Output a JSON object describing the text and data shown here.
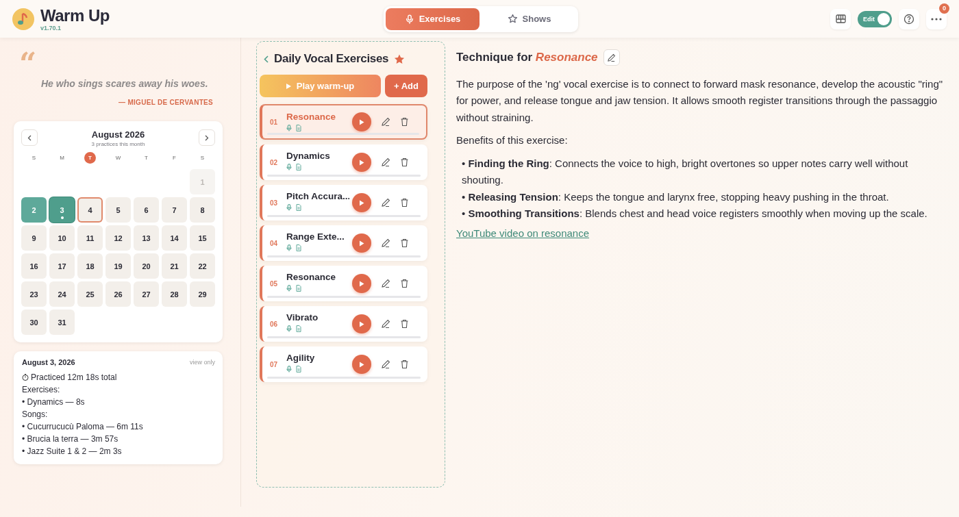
{
  "app": {
    "title": "Warm Up",
    "version": "v1.70.1"
  },
  "nav_tabs": [
    {
      "label": "Exercises",
      "selected": true
    },
    {
      "label": "Shows",
      "selected": false
    }
  ],
  "toolbar": {
    "edit_toggle": {
      "label": "Edit",
      "on": true
    },
    "notification_count": "0"
  },
  "quote": {
    "mark": "“",
    "text": "He who sings scares away his woes.",
    "author": "— MIGUEL DE CERVANTES"
  },
  "calendar": {
    "month": "August 2026",
    "subtitle": "3 practices this month",
    "weekdays": [
      {
        "label": "S",
        "selected": false
      },
      {
        "label": "M",
        "selected": false
      },
      {
        "label": "T",
        "selected": true
      },
      {
        "label": "W",
        "selected": false
      },
      {
        "label": "T",
        "selected": false
      },
      {
        "label": "F",
        "selected": false
      },
      {
        "label": "S",
        "selected": false
      }
    ],
    "days": [
      {
        "label": "1",
        "practiced": false,
        "selected": false,
        "today": false,
        "muted": true
      },
      {
        "label": "2",
        "practiced": true,
        "selected": false,
        "today": false,
        "muted": false
      },
      {
        "label": "3",
        "practiced": true,
        "selected": true,
        "today": false,
        "muted": false
      },
      {
        "label": "4",
        "practiced": false,
        "selected": false,
        "today": true,
        "muted": false
      },
      {
        "label": "5",
        "practiced": false,
        "selected": false,
        "today": false,
        "muted": false
      },
      {
        "label": "6",
        "practiced": false,
        "selected": false,
        "today": false,
        "muted": false
      },
      {
        "label": "7",
        "practiced": false,
        "selected": false,
        "today": false,
        "muted": false
      },
      {
        "label": "8",
        "practiced": false,
        "selected": false,
        "today": false,
        "muted": false
      },
      {
        "label": "9",
        "practiced": false,
        "selected": false,
        "today": false,
        "muted": false
      },
      {
        "label": "10",
        "practiced": false,
        "selected": false,
        "today": false,
        "muted": false
      },
      {
        "label": "11",
        "practiced": false,
        "selected": false,
        "today": false,
        "muted": false
      },
      {
        "label": "12",
        "practiced": false,
        "selected": false,
        "today": false,
        "muted": false
      },
      {
        "label": "13",
        "practiced": false,
        "selected": false,
        "today": false,
        "muted": false
      },
      {
        "label": "14",
        "practiced": false,
        "selected": false,
        "today": false,
        "muted": false
      },
      {
        "label": "15",
        "practiced": false,
        "selected": false,
        "today": false,
        "muted": false
      },
      {
        "label": "16",
        "practiced": false,
        "selected": false,
        "today": false,
        "muted": false
      },
      {
        "label": "17",
        "practiced": false,
        "selected": false,
        "today": false,
        "muted": false
      },
      {
        "label": "18",
        "practiced": false,
        "selected": false,
        "today": false,
        "muted": false
      },
      {
        "label": "19",
        "practiced": false,
        "selected": false,
        "today": false,
        "muted": false
      },
      {
        "label": "20",
        "practiced": false,
        "selected": false,
        "today": false,
        "muted": false
      },
      {
        "label": "21",
        "practiced": false,
        "selected": false,
        "today": false,
        "muted": false
      },
      {
        "label": "22",
        "practiced": false,
        "selected": false,
        "today": false,
        "muted": false
      },
      {
        "label": "23",
        "practiced": false,
        "selected": false,
        "today": false,
        "muted": false
      },
      {
        "label": "24",
        "practiced": false,
        "selected": false,
        "today": false,
        "muted": false
      },
      {
        "label": "25",
        "practiced": false,
        "selected": false,
        "today": false,
        "muted": false
      },
      {
        "label": "26",
        "practiced": false,
        "selected": false,
        "today": false,
        "muted": false
      },
      {
        "label": "27",
        "practiced": false,
        "selected": false,
        "today": false,
        "muted": false
      },
      {
        "label": "28",
        "practiced": false,
        "selected": false,
        "today": false,
        "muted": false
      },
      {
        "label": "29",
        "practiced": false,
        "selected": false,
        "today": false,
        "muted": false
      },
      {
        "label": "30",
        "practiced": false,
        "selected": false,
        "today": false,
        "muted": false
      },
      {
        "label": "31",
        "practiced": false,
        "selected": false,
        "today": false,
        "muted": false
      }
    ]
  },
  "day_log": {
    "date": "August 3, 2026",
    "mode": "view only",
    "total": "Practiced 12m 18s total",
    "lines": [
      "Exercises:",
      "• Dynamics — 8s",
      "Songs:",
      "• Cucurrucucù Paloma — 6m 11s",
      "• Brucia la terra — 3m 57s",
      "• Jazz Suite 1 & 2 — 2m 3s"
    ]
  },
  "routine": {
    "title": "Daily Vocal Exercises",
    "favorite": true,
    "play_label": "Play warm-up",
    "add_label": "+ Add",
    "exercises": [
      {
        "number": "01",
        "name": "Resonance",
        "selected": true
      },
      {
        "number": "02",
        "name": "Dynamics",
        "selected": false
      },
      {
        "number": "03",
        "name": "Pitch Accura...",
        "selected": false
      },
      {
        "number": "04",
        "name": "Range Exte...",
        "selected": false
      },
      {
        "number": "05",
        "name": "Resonance",
        "selected": false
      },
      {
        "number": "06",
        "name": "Vibrato",
        "selected": false
      },
      {
        "number": "07",
        "name": "Agility",
        "selected": false
      }
    ]
  },
  "technique": {
    "title": "Technique for *Resonance*",
    "description": "The purpose of the 'ng' vocal exercise is to connect to forward mask resonance, develop the acoustic \"ring\" for power, and release tongue and jaw tension. It allows smooth register transitions through the passaggio without straining.",
    "benefits_heading": "Benefits of this exercise:",
    "benefits": [
      "• **Finding the Ring**: Connects the voice to high, bright overtones so upper notes carry well without shouting.",
      "• **Releasing Tension**: Keeps the tongue and larynx free, stopping heavy pushing in the throat.",
      "• **Smoothing Transitions**: Blends chest and head voice registers smoothly when moving up the scale."
    ],
    "link": "YouTube video on resonance"
  }
}
